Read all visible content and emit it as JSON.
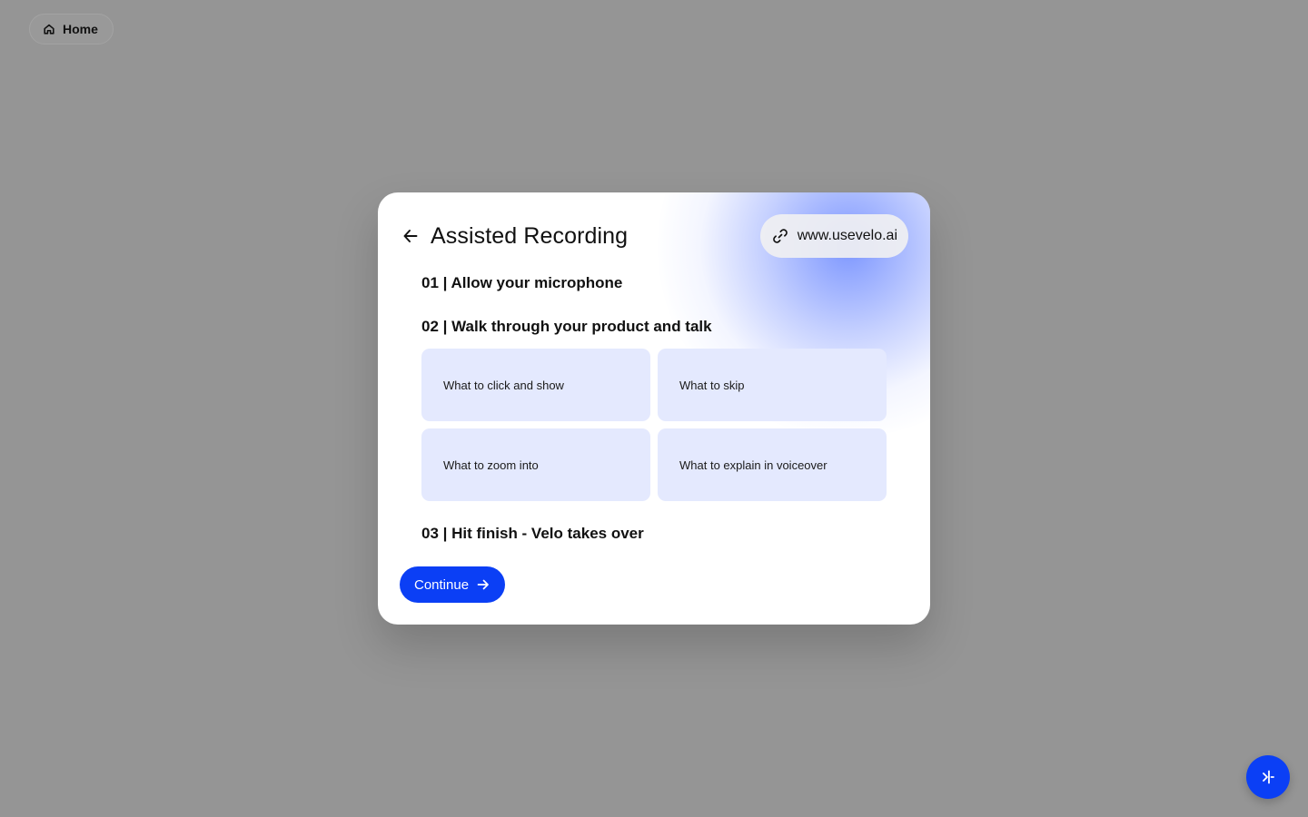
{
  "home_button": {
    "label": "Home",
    "icon": "home-icon"
  },
  "modal": {
    "title": "Assisted Recording",
    "back_icon": "arrow-left-icon",
    "url_pill": {
      "icon": "link-icon",
      "text": "www.usevelo.ai"
    },
    "steps": [
      {
        "label": "01 | Allow your microphone"
      },
      {
        "label": "02 | Walk through your product and talk"
      },
      {
        "label": "03 | Hit finish - Velo takes over"
      }
    ],
    "tiles": [
      {
        "label": "What to click and show"
      },
      {
        "label": "What to skip"
      },
      {
        "label": "What to zoom into"
      },
      {
        "label": "What to explain in voiceover"
      }
    ],
    "continue_button": {
      "label": "Continue",
      "icon": "arrow-right-icon"
    }
  },
  "fab": {
    "icon": "velo-logo-icon"
  },
  "colors": {
    "backdrop": "#959595",
    "accent": "#0b3ff5",
    "tile_bg": "#e4e9fe",
    "card_bg": "#ffffff"
  }
}
